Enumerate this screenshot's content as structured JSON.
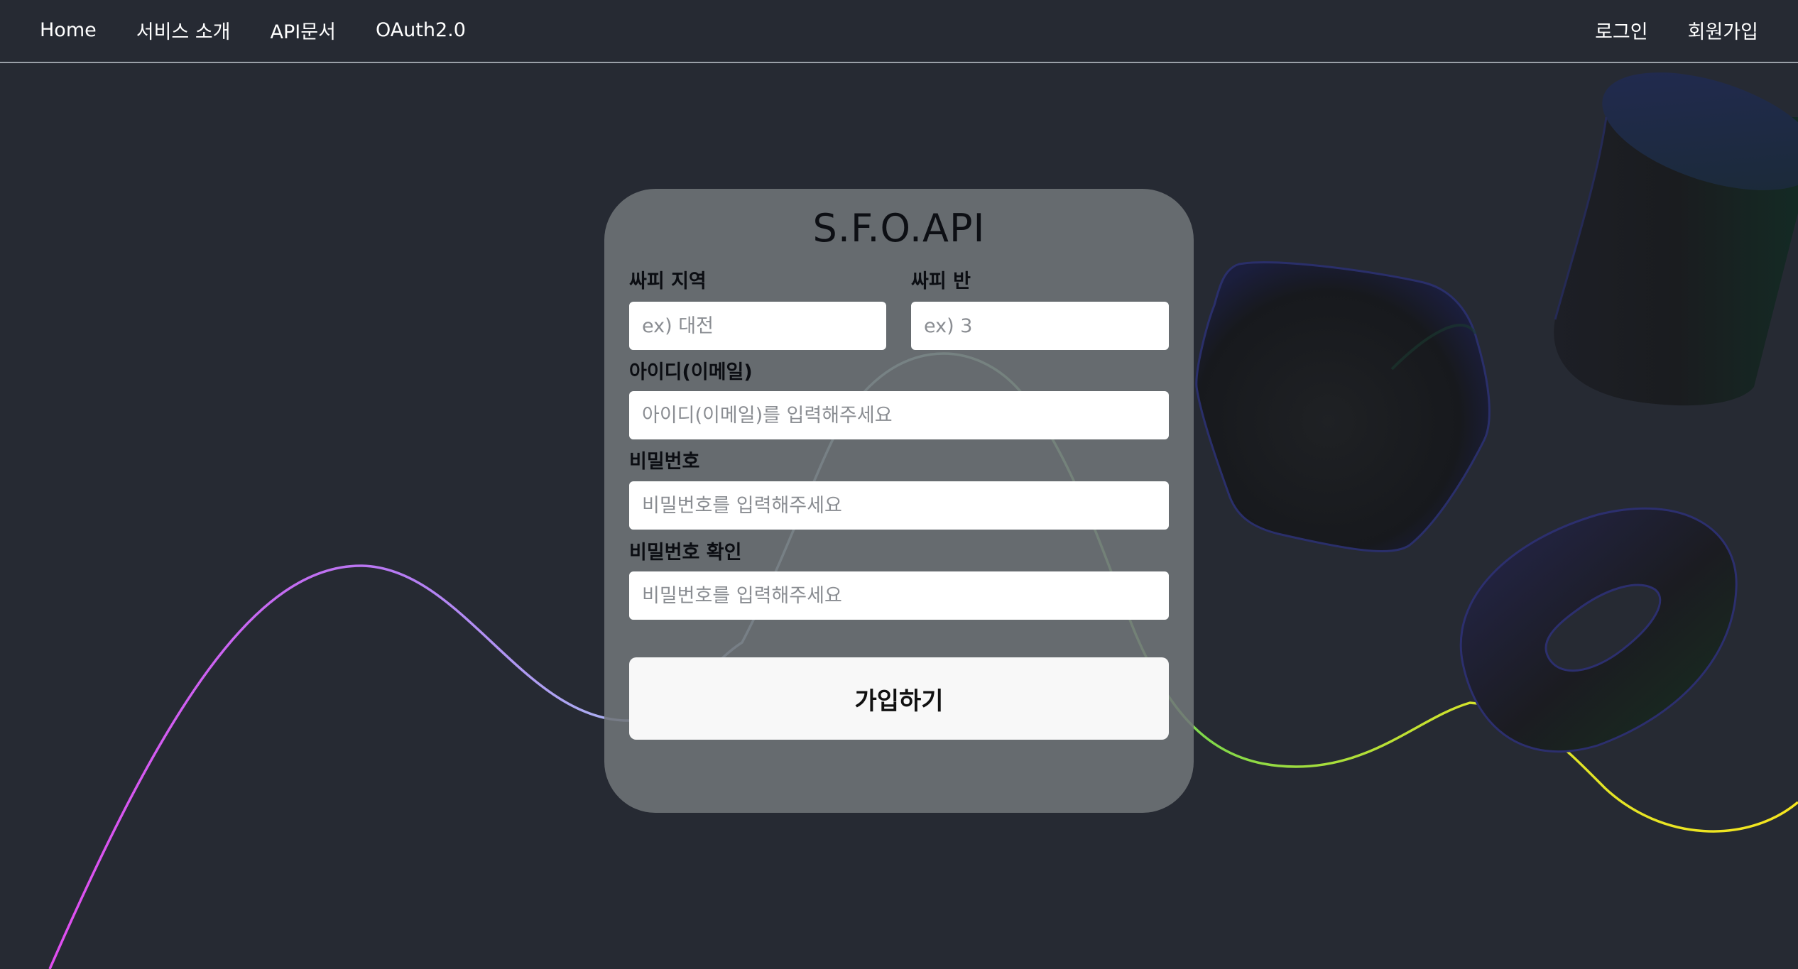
{
  "nav": {
    "left": [
      {
        "label": "Home"
      },
      {
        "label": "서비스 소개"
      },
      {
        "label": "API문서"
      },
      {
        "label": "OAuth2.0"
      }
    ],
    "right": [
      {
        "label": "로그인"
      },
      {
        "label": "회원가입"
      }
    ]
  },
  "form": {
    "title": "S.F.O.API",
    "region": {
      "label": "싸피 지역",
      "placeholder": "ex) 대전",
      "value": ""
    },
    "class": {
      "label": "싸피 반",
      "placeholder": "ex) 3",
      "value": ""
    },
    "email": {
      "label": "아이디(이메일)",
      "placeholder": "아이디(이메일)를 입력해주세요",
      "value": ""
    },
    "password": {
      "label": "비밀번호",
      "placeholder": "비밀번호를 입력해주세요",
      "value": ""
    },
    "password_confirm": {
      "label": "비밀번호 확인",
      "placeholder": "비밀번호를 입력해주세요",
      "value": ""
    },
    "submit_label": "가입하기"
  },
  "colors": {
    "background": "#262a33",
    "card": "#707478",
    "wave_start": "#e04df0",
    "wave_mid": "#a9e8d8",
    "wave_green": "#7fd84a",
    "wave_end": "#f5e51f"
  }
}
